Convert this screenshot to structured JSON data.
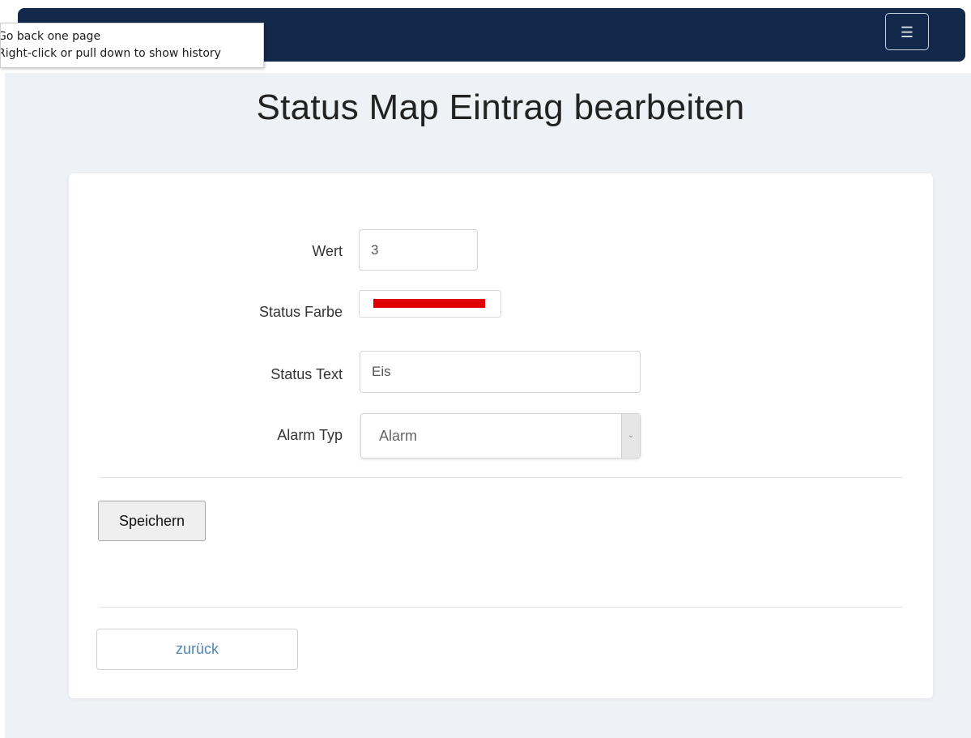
{
  "tooltip": {
    "line1": "Go back one page",
    "line2": "Right-click or pull down to show history"
  },
  "header": {
    "menu_icon": "hamburger-icon",
    "menu_glyph": "☰"
  },
  "page": {
    "title": "Status Map Eintrag bearbeiten"
  },
  "form": {
    "wert": {
      "label": "Wert",
      "value": "3"
    },
    "status_farbe": {
      "label": "Status Farbe",
      "value": "#e00000"
    },
    "status_text": {
      "label": "Status Text",
      "value": "Eis"
    },
    "alarm_typ": {
      "label": "Alarm Typ",
      "selected": "Alarm",
      "arrow_icon": "chevron-down-icon",
      "arrow_glyph": "⌄"
    },
    "save_label": "Speichern"
  },
  "back": {
    "label": "zurück"
  },
  "colors": {
    "navbar": "#13294b",
    "page_background": "#eef1f5",
    "card": "#ffffff",
    "link": "#4e86b4"
  }
}
